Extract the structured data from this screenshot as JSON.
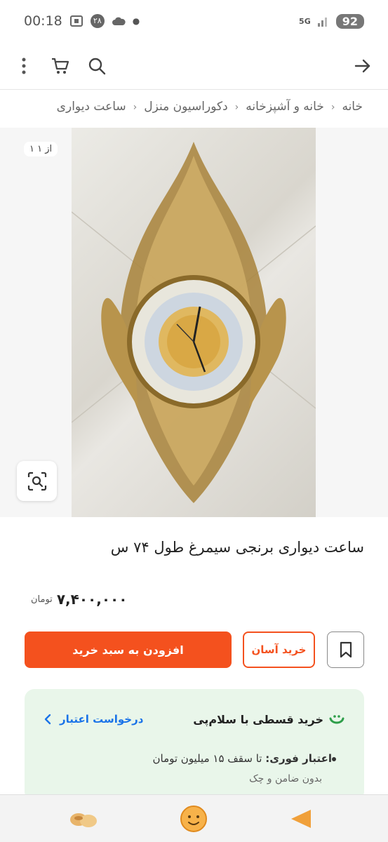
{
  "status": {
    "time": "00:18",
    "notif_count": "۲۸",
    "network": "5G",
    "battery": "92"
  },
  "breadcrumbs": [
    "خانه",
    "خانه و آشپزخانه",
    "دکوراسیون منزل",
    "ساعت دیواری"
  ],
  "gallery": {
    "counter": "۱ از ۱"
  },
  "product": {
    "title": "ساعت دیواری برنجی سیمرغ طول ۷۴ س",
    "price": "۷,۴۰۰,۰۰۰",
    "currency": "تومان"
  },
  "actions": {
    "add_to_cart": "افزودن به سبد خرید",
    "easy_buy": "خرید آسان"
  },
  "credit": {
    "title": "خرید قسطی با سلام‌پی",
    "request_link": "درخواست اعتبار",
    "instant_label": "اعتبار فوری:",
    "instant_value": "تا سقف ۱۵ میلیون تومان",
    "note": "بدون ضامن و چک"
  },
  "colors": {
    "accent": "#f4511e",
    "credit_bg": "#e9f6ea",
    "link": "#1a73e8"
  },
  "icons": [
    "back-arrow-icon",
    "search-icon",
    "cart-icon",
    "more-icon",
    "visual-search-icon",
    "bookmark-icon",
    "chevron-left-icon",
    "chevron-right-icon",
    "play-icon",
    "home-icon",
    "nav-icon"
  ]
}
